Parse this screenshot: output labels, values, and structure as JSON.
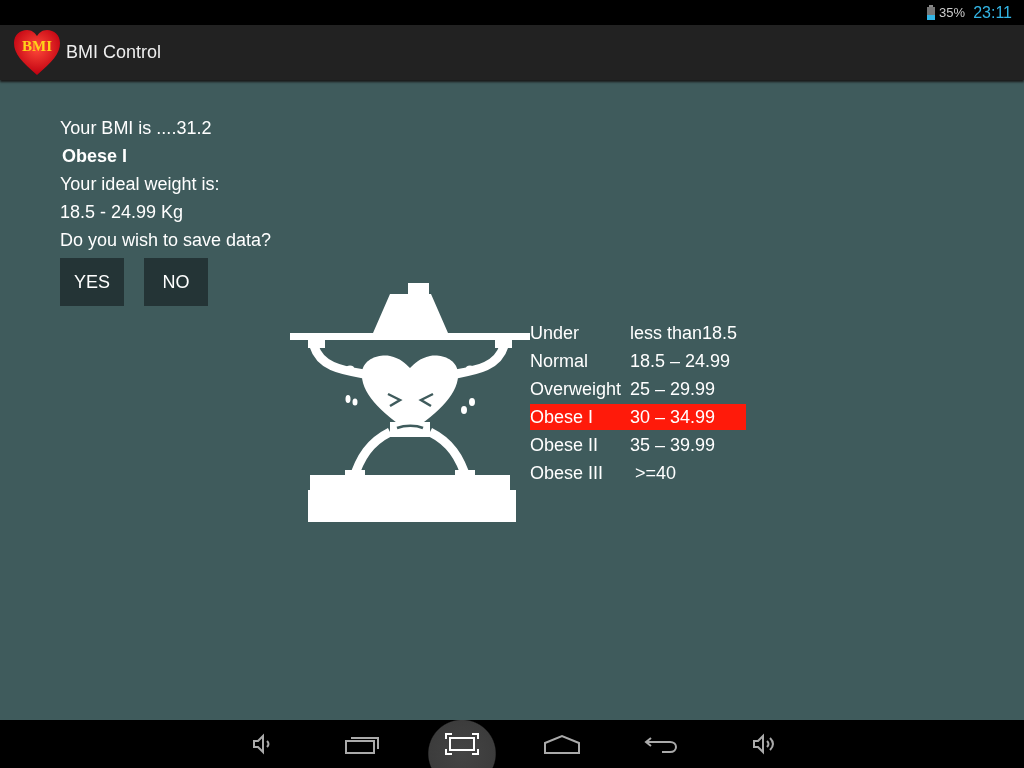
{
  "status_bar": {
    "battery": "35%",
    "time": "23:11"
  },
  "app_bar": {
    "logo_text": "BMI",
    "title": "BMI Control"
  },
  "result": {
    "bmi_line": "Your BMI is ....31.2",
    "category": "Obese I",
    "ideal_label": "Your ideal weight is:",
    "ideal_range": "18.5  -  24.99 Kg",
    "prompt": "Do you wish to save data?"
  },
  "buttons": [
    "YES",
    "NO"
  ],
  "categories": [
    {
      "name": "Under",
      "range": "less than18.5",
      "selected": false
    },
    {
      "name": "Normal",
      "range": "18.5 – 24.99",
      "selected": false
    },
    {
      "name": "Overweight",
      "range": "25 – 29.99",
      "selected": false
    },
    {
      "name": "Obese I",
      "range": "30 – 34.99",
      "selected": true
    },
    {
      "name": "Obese II",
      "range": "35 – 39.99",
      "selected": false
    },
    {
      "name": "Obese III",
      "range": " >=40",
      "selected": false
    }
  ]
}
